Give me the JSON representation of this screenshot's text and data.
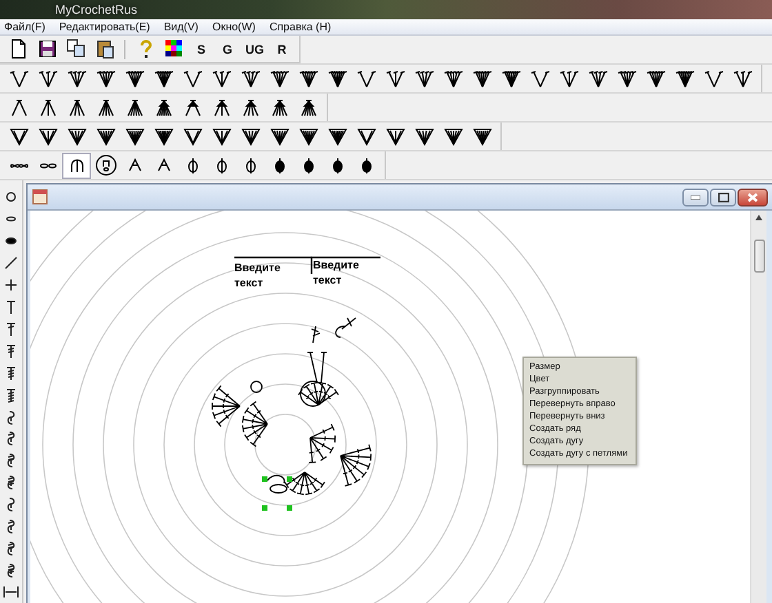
{
  "app": {
    "title": "MyCrochetRus"
  },
  "menu": [
    "Файл(F)",
    "Редактировать(E)",
    "Вид(V)",
    "Окно(W)",
    "Справка (H)"
  ],
  "main_toolbar": {
    "text_buttons": [
      "S",
      "G",
      "UG",
      "R"
    ]
  },
  "stitch_toolbars": [
    {
      "buttons": [
        {
          "selected": false
        },
        {
          "selected": false
        },
        {
          "selected": false
        },
        {
          "selected": false
        },
        {
          "selected": false
        },
        {
          "selected": false
        },
        {
          "selected": false
        },
        {
          "selected": false
        },
        {
          "selected": false
        },
        {
          "selected": false
        },
        {
          "selected": false
        },
        {
          "selected": false
        },
        {
          "selected": false
        },
        {
          "selected": false
        },
        {
          "selected": false
        },
        {
          "selected": false
        },
        {
          "selected": false
        },
        {
          "selected": false
        },
        {
          "selected": false
        },
        {
          "selected": false
        },
        {
          "selected": false
        },
        {
          "selected": false
        },
        {
          "selected": false
        },
        {
          "selected": false
        },
        {
          "selected": false
        },
        {
          "selected": false
        }
      ]
    },
    {
      "buttons": [
        {
          "selected": false
        },
        {
          "selected": false
        },
        {
          "selected": false
        },
        {
          "selected": false
        },
        {
          "selected": false
        },
        {
          "selected": false
        },
        {
          "selected": false
        },
        {
          "selected": false
        },
        {
          "selected": false
        },
        {
          "selected": false
        },
        {
          "selected": false
        }
      ]
    },
    {
      "buttons": [
        {
          "selected": false
        },
        {
          "selected": false
        },
        {
          "selected": false
        },
        {
          "selected": false
        },
        {
          "selected": false
        },
        {
          "selected": false
        },
        {
          "selected": false
        },
        {
          "selected": false
        },
        {
          "selected": false
        },
        {
          "selected": false
        },
        {
          "selected": false
        },
        {
          "selected": false
        },
        {
          "selected": false
        },
        {
          "selected": false
        },
        {
          "selected": false
        },
        {
          "selected": false
        },
        {
          "selected": false
        }
      ]
    },
    {
      "buttons": [
        {
          "selected": false
        },
        {
          "selected": false
        },
        {
          "selected": true
        },
        {
          "selected": false
        },
        {
          "selected": false
        },
        {
          "selected": false
        },
        {
          "selected": false
        },
        {
          "selected": false
        },
        {
          "selected": false
        },
        {
          "selected": false
        },
        {
          "selected": false
        },
        {
          "selected": false
        },
        {
          "selected": false
        }
      ]
    }
  ],
  "side_toolbar": {
    "buttons": [
      {
        "selected": false
      },
      {
        "selected": false
      },
      {
        "selected": false
      },
      {
        "selected": false
      },
      {
        "selected": false
      },
      {
        "selected": false
      },
      {
        "selected": false
      },
      {
        "selected": false
      },
      {
        "selected": false
      },
      {
        "selected": false
      },
      {
        "selected": false
      },
      {
        "selected": false
      },
      {
        "selected": false
      },
      {
        "selected": false
      },
      {
        "selected": false
      },
      {
        "selected": false
      },
      {
        "selected": false
      },
      {
        "selected": false
      },
      {
        "selected": false
      }
    ]
  },
  "chart_window": {
    "text_labels": [
      "Введите текст",
      "Введите текст"
    ]
  },
  "context_menu": {
    "items": [
      "Размер",
      "Цвет",
      "Разгруппировать",
      "Перевернуть вправо",
      "Перевернуть вниз",
      "Создать ряд",
      "Создать дугу",
      "Создать дугу с петлями"
    ]
  }
}
